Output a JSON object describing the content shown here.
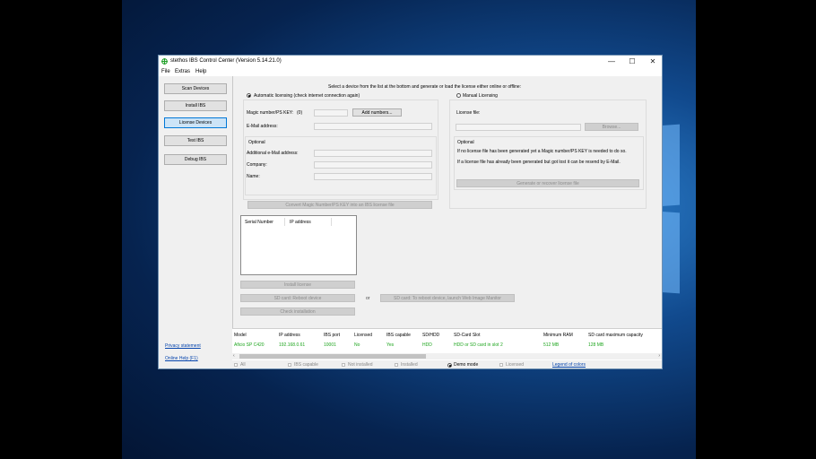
{
  "window": {
    "title": "stethos IBS Control Center (Version 5.14.21.0)"
  },
  "menu": [
    "File",
    "Extras",
    "Help"
  ],
  "sidebar": {
    "buttons": [
      "Scan Devices",
      "Install IBS",
      "License Devices",
      "Test IBS",
      "Debug IBS"
    ],
    "active": "License Devices",
    "links": [
      "Privacy statement",
      "Online Help (F1)"
    ]
  },
  "license": {
    "instruction": "Select a device from the list at the bottom and generate or load the license either online or offline:",
    "auto_label": "Automatic licensing (check internet connection again)",
    "manual_label": "Manual Licensing",
    "magic_label": "Magic number/PS KEY:",
    "magic_count": "(0)",
    "add_numbers": "Add numbers...",
    "email_label": "E-Mail address:",
    "optional_title": "Optional",
    "additional_email": "Additional e-Mail address:",
    "company": "Company:",
    "name": "Name:",
    "convert_button": "Convert Magic Number/PS KEY into an IBS license file",
    "license_file_label": "License file:",
    "browse": "Browse...",
    "optional_right_title": "Optional",
    "optional_right_text_1": "If no license file has been generated yet a Magic number/PS KEY is needed to do so.",
    "optional_right_text_2": "If a license file has already been generated but got lost it can be resend by E-Mail.",
    "generate_button": "Generate or recover license file"
  },
  "serial_list": {
    "columns": [
      "Serial Number",
      "IP address"
    ]
  },
  "actions": {
    "install_license": "Install license",
    "sd_reboot": "SD card: Reboot device",
    "or": "or",
    "sd_launch": "SD card: To reboot device, launch Web Image Manitor",
    "check_install": "Check installation"
  },
  "devices": {
    "columns": [
      "Model",
      "IP address",
      "IBS port",
      "Licensed",
      "IBS capable",
      "SD/HDD",
      "SD-Card Slot",
      "Minimum RAM",
      "SD card maximum capacity"
    ],
    "rows": [
      [
        "Aficio SP C420",
        "192.168.0.61",
        "10001",
        "No",
        "Yes",
        "HDD",
        "HDD or SD card in slot 2",
        "512 MB",
        "128 MB"
      ]
    ]
  },
  "filters": {
    "items": [
      "All",
      "IBS capable",
      "Not installed",
      "Installed",
      "Demo mode",
      "Licensed"
    ],
    "selected": "Demo mode",
    "legend": "Legend of colors"
  },
  "colors": {
    "accent": "#0078d7",
    "device_row": "#1ea51e",
    "link": "#0645ad"
  }
}
